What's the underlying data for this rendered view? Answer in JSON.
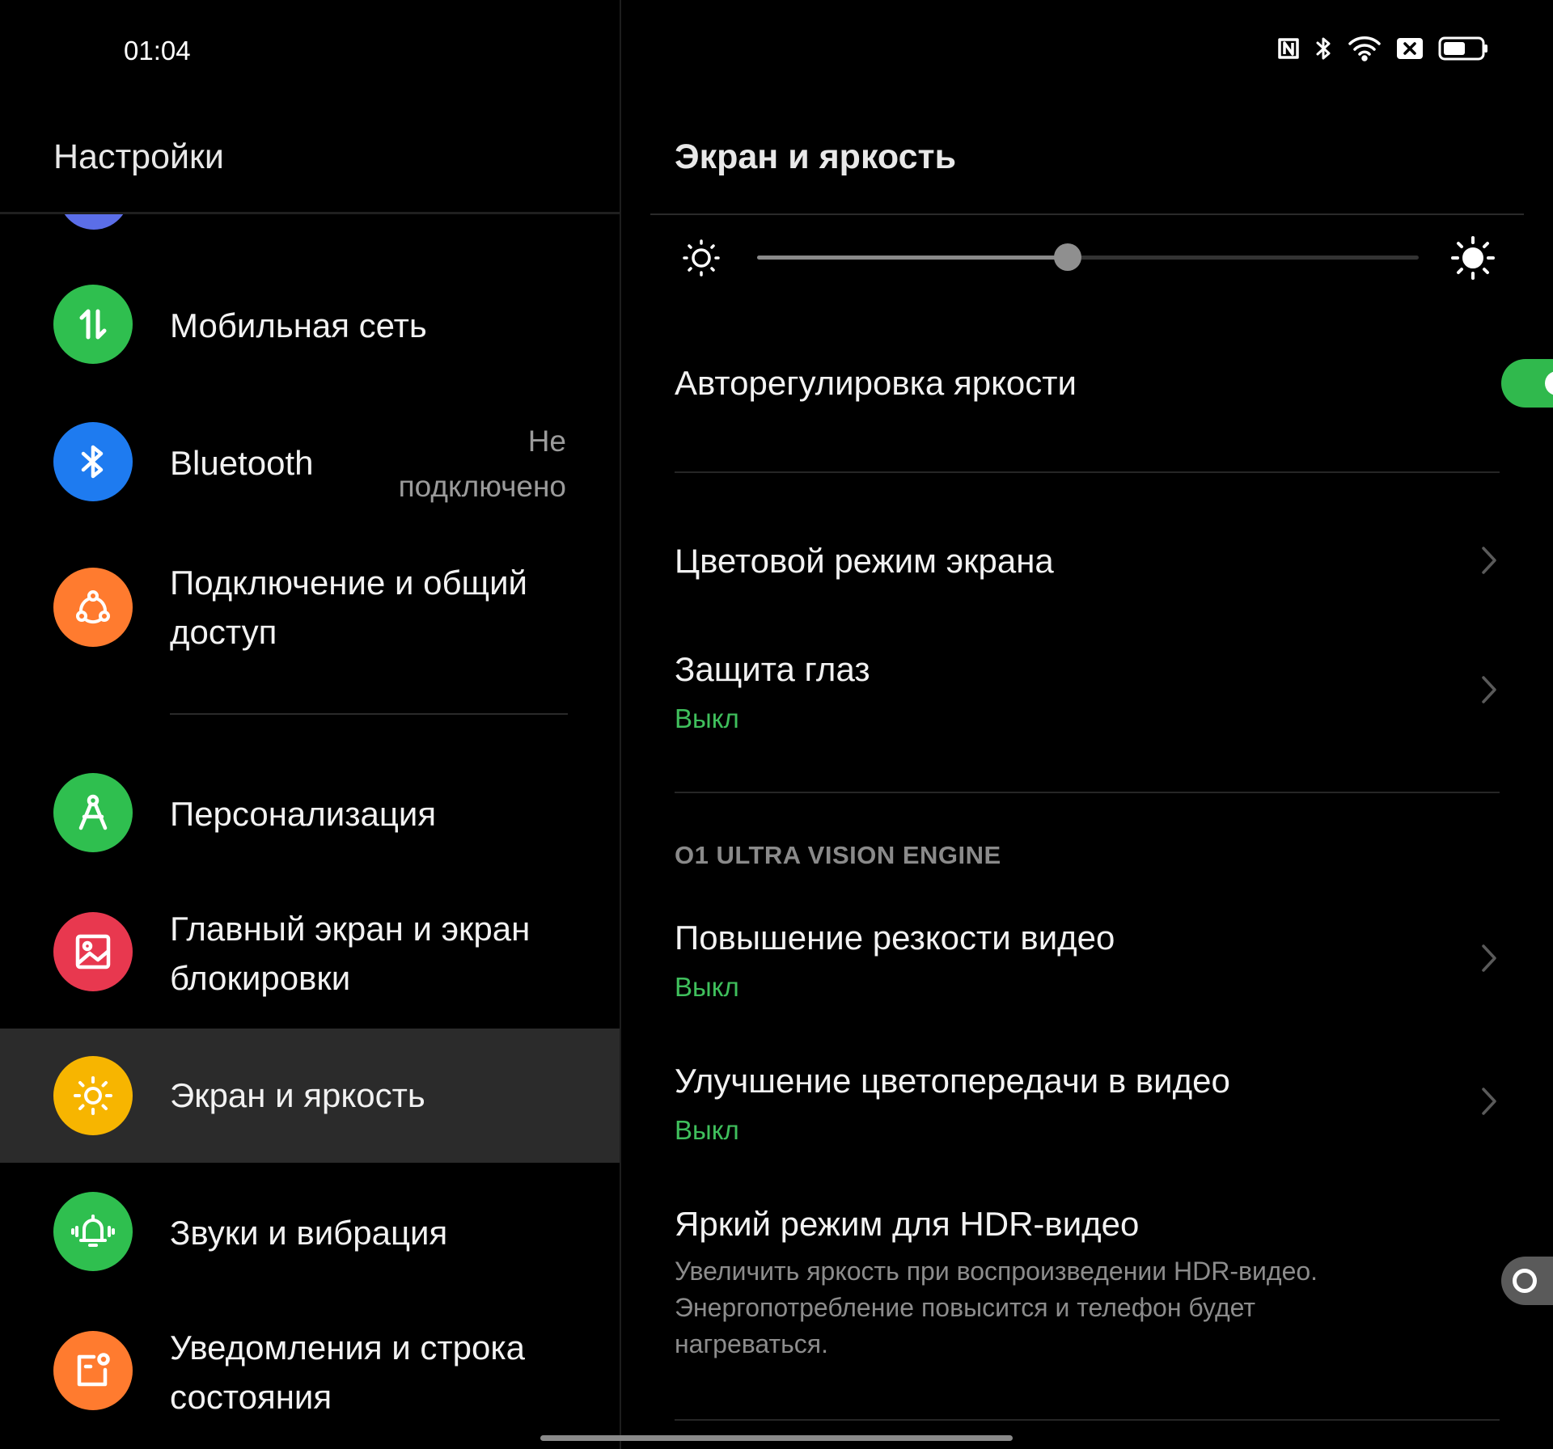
{
  "status_bar": {
    "time": "01:04",
    "icons": [
      "nfc-icon",
      "bluetooth-icon",
      "wifi-icon",
      "sim-disabled-icon",
      "battery-icon"
    ]
  },
  "left": {
    "title": "Настройки",
    "items": [
      {
        "label": "Мобильная сеть",
        "icon": "mobile-data-icon",
        "color": "#2fbf4f"
      },
      {
        "label": "Bluetooth",
        "value": "Не подключено",
        "value_line1": "Не",
        "value_line2": "подключено",
        "icon": "bluetooth-icon",
        "color": "#1e7bf0"
      },
      {
        "label": "Подключение и общий доступ",
        "label_line1": "Подключение и общий",
        "label_line2": "доступ",
        "icon": "share-icon",
        "color": "#ff7b2f"
      },
      {
        "label": "Персонализация",
        "icon": "personalization-icon",
        "color": "#2fbf4f"
      },
      {
        "label": "Главный экран и экран блокировки",
        "label_line1": "Главный экран и экран",
        "label_line2": "блокировки",
        "icon": "image-icon",
        "color": "#e8384f"
      },
      {
        "label": "Экран и яркость",
        "icon": "sun-icon",
        "color": "#f7b500",
        "selected": true
      },
      {
        "label": "Звуки и вибрация",
        "icon": "bell-icon",
        "color": "#2fbf4f"
      },
      {
        "label": "Уведомления и строка состояния",
        "label_line1": "Уведомления и строка",
        "label_line2": "состояния",
        "icon": "notification-icon",
        "color": "#ff7b2f"
      }
    ]
  },
  "right": {
    "title": "Экран и яркость",
    "brightness": {
      "level": 0.47
    },
    "auto_brightness": {
      "label": "Авторегулировка яркости",
      "on": true
    },
    "color_mode": {
      "label": "Цветовой режим экрана"
    },
    "eye_protection": {
      "label": "Защита глаз",
      "status": "Выкл"
    },
    "section_header": "O1 ULTRA VISION ENGINE",
    "video_sharpness": {
      "label": "Повышение резкости видео",
      "status": "Выкл"
    },
    "video_color": {
      "label": "Улучшение цветопередачи в видео",
      "status": "Выкл"
    },
    "hdr_bright": {
      "label": "Яркий режим для HDR-видео",
      "desc_line1": "Увеличить яркость при воспроизведении HDR-видео.",
      "desc_line2": "Энергопотребление повысится и телефон будет",
      "desc_line3": "нагреваться.",
      "on": false
    }
  },
  "colors": {
    "accent_green": "#3fbf5c",
    "toggle_on": "#30b94d",
    "toggle_off": "#5a5a5a",
    "selected_bg": "#2b2b2b"
  }
}
